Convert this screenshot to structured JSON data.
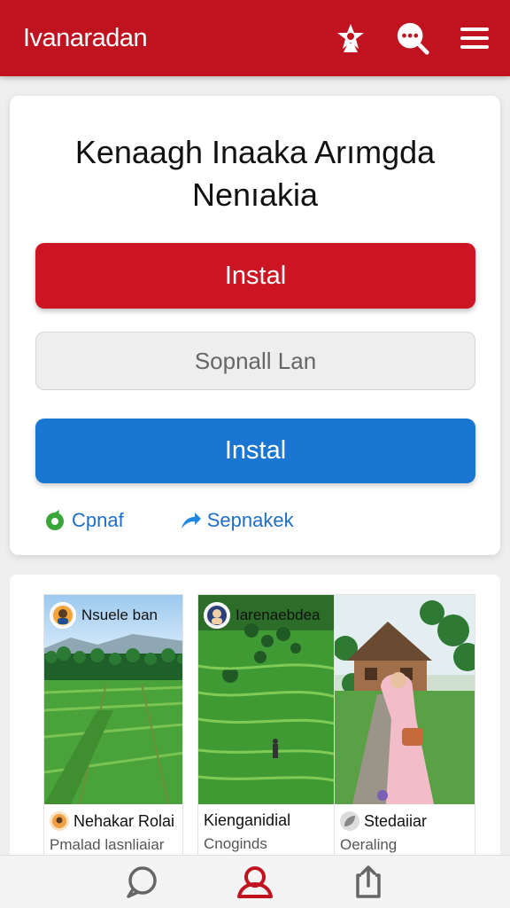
{
  "app": {
    "title": "Ivanaradan"
  },
  "header_icons": [
    "star-person-icon",
    "search-chat-icon",
    "menu-icon"
  ],
  "card": {
    "title": "Kenaagh Inaaka Arımgda Nenıakia",
    "primary_button": "Instal",
    "secondary_button": "Sopnall Lan",
    "tertiary_button": "Instal",
    "links": [
      {
        "label": "Cpnaf",
        "icon": "refresh-leaf-icon"
      },
      {
        "label": "Sepnakek",
        "icon": "share-arrow-icon"
      }
    ]
  },
  "posts": [
    {
      "tag": "Nsuele ban",
      "author": "Nehakar Rolai",
      "subtitle": "Pmalad lasnliaiar"
    },
    {
      "tag": "Iarenaebdea",
      "author": "Kienganidial",
      "subtitle": "Cnoginds"
    },
    {
      "tag": "",
      "author": "Stedaiiar",
      "subtitle": "Oeraling"
    }
  ],
  "colors": {
    "brand_red": "#c1121f",
    "button_red": "#cc1423",
    "button_blue": "#1976d2",
    "link_blue": "#1e6fc8"
  },
  "bottom_nav": [
    "chat-icon",
    "profile-icon",
    "share-icon"
  ]
}
